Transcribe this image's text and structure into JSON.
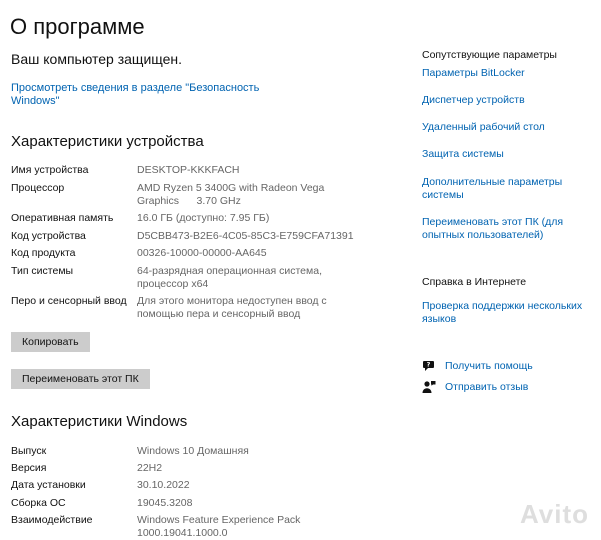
{
  "header": {
    "title": "О программе",
    "protected_text": "Ваш компьютер защищен.",
    "security_link": "Просмотреть сведения в разделе \"Безопасность Windows\""
  },
  "device": {
    "section_title": "Характеристики устройства",
    "rows": [
      {
        "label": "Имя устройства",
        "value": "DESKTOP-KKKFACH"
      },
      {
        "label": "Процессор",
        "value": "AMD Ryzen 5 3400G with Radeon Vega Graphics      3.70 GHz"
      },
      {
        "label": "Оперативная память",
        "value": "16.0 ГБ (доступно: 7.95 ГБ)"
      },
      {
        "label": "Код устройства",
        "value": "D5CBB473-B2E6-4C05-85C3-E759CFA71391"
      },
      {
        "label": "Код продукта",
        "value": "00326-10000-00000-AA645"
      },
      {
        "label": "Тип системы",
        "value": "64-разрядная операционная система, процессор x64"
      },
      {
        "label": "Перо и сенсорный ввод",
        "value": "Для этого монитора недоступен ввод с помощью пера и сенсорный ввод"
      }
    ],
    "copy_button": "Копировать",
    "rename_button": "Переименовать этот ПК"
  },
  "windows": {
    "section_title": "Характеристики Windows",
    "rows": [
      {
        "label": "Выпуск",
        "value": "Windows 10 Домашняя"
      },
      {
        "label": "Версия",
        "value": "22H2"
      },
      {
        "label": "Дата установки",
        "value": "30.10.2022"
      },
      {
        "label": "Сборка ОС",
        "value": "19045.3208"
      },
      {
        "label": "Взаимодействие",
        "value": "Windows Feature Experience Pack 1000.19041.1000.0"
      }
    ]
  },
  "sidebar": {
    "related_title": "Сопутствующие параметры",
    "related_links": [
      "Параметры BitLocker",
      "Диспетчер устройств",
      "Удаленный рабочий стол",
      "Защита системы",
      "Дополнительные параметры системы",
      "Переименовать этот ПК (для опытных пользователей)"
    ],
    "internet_title": "Справка в Интернете",
    "internet_link": "Проверка поддержки нескольких языков",
    "get_help": "Получить помощь",
    "feedback": "Отправить отзыв"
  },
  "watermark": "Avito",
  "colors": {
    "link": "#0063b1",
    "button": "#cccccc"
  }
}
